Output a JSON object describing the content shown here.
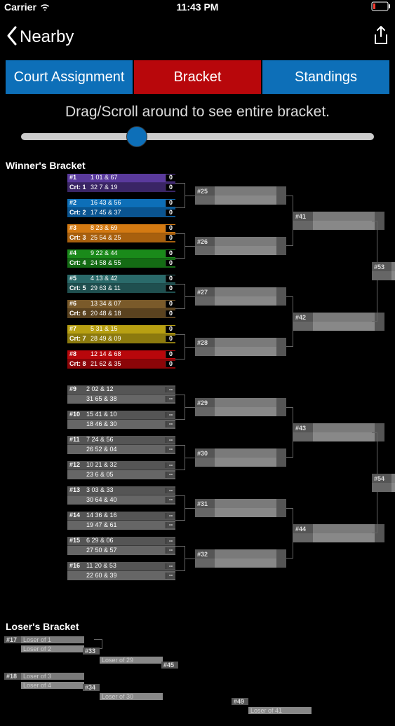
{
  "status": {
    "carrier": "Carrier",
    "time": "11:43 PM"
  },
  "nav": {
    "back_label": "Nearby"
  },
  "tabs": {
    "court_assignment": "Court Assignment",
    "bracket": "Bracket",
    "standings": "Standings"
  },
  "instructions": "Drag/Scroll around to see entire bracket.",
  "winner_header": "Winner's Bracket",
  "loser_header": "Loser's Bracket",
  "winner_r1": [
    {
      "seed": "#1",
      "line1_left": "1",
      "line1": "01 & 67",
      "crt": "Crt: 1",
      "line2_left": "32",
      "line2": "7 & 19",
      "s1": "0",
      "s2": "0",
      "color": "c-purple"
    },
    {
      "seed": "#2",
      "line1_left": "16",
      "line1": "43 & 56",
      "crt": "Crt: 2",
      "line2_left": "17",
      "line2": "45 & 37",
      "s1": "0",
      "s2": "0",
      "color": "c-blue1"
    },
    {
      "seed": "#3",
      "line1_left": "8",
      "line1": "23 & 69",
      "crt": "Crt: 3",
      "line2_left": "25",
      "line2": "54 & 25",
      "s1": "0",
      "s2": "0",
      "color": "c-orange"
    },
    {
      "seed": "#4",
      "line1_left": "9",
      "line1": "22 & 44",
      "crt": "Crt: 4",
      "line2_left": "24",
      "line2": "58 & 55",
      "s1": "0",
      "s2": "0",
      "color": "c-green"
    },
    {
      "seed": "#5",
      "line1_left": "4",
      "line1": "13 & 42",
      "crt": "Crt: 5",
      "line2_left": "29",
      "line2": "63 & 11",
      "s1": "0",
      "s2": "0",
      "color": "c-teal"
    },
    {
      "seed": "#6",
      "line1_left": "13",
      "line1": "34 & 07",
      "crt": "Crt: 6",
      "line2_left": "20",
      "line2": "48 & 18",
      "s1": "0",
      "s2": "0",
      "color": "c-brown"
    },
    {
      "seed": "#7",
      "line1_left": "5",
      "line1": "31 & 15",
      "crt": "Crt: 7",
      "line2_left": "28",
      "line2": "49 & 09",
      "s1": "0",
      "s2": "0",
      "color": "c-gold"
    },
    {
      "seed": "#8",
      "line1_left": "12",
      "line1": "14 & 68",
      "crt": "Crt: 8",
      "line2_left": "21",
      "line2": "62 & 35",
      "s1": "0",
      "s2": "0",
      "color": "c-red"
    },
    {
      "seed": "#9",
      "line1_left": "2",
      "line1": "02 & 12",
      "crt": "",
      "line2_left": "31",
      "line2": "65 & 38",
      "s1": "--",
      "s2": "--",
      "color": "c-gray"
    },
    {
      "seed": "#10",
      "line1_left": "15",
      "line1": "41 & 10",
      "crt": "",
      "line2_left": "18",
      "line2": "46 & 30",
      "s1": "--",
      "s2": "--",
      "color": "c-gray"
    },
    {
      "seed": "#11",
      "line1_left": "7",
      "line1": "24 & 56",
      "crt": "",
      "line2_left": "26",
      "line2": "52 & 04",
      "s1": "--",
      "s2": "--",
      "color": "c-gray"
    },
    {
      "seed": "#12",
      "line1_left": "10",
      "line1": "21 & 32",
      "crt": "",
      "line2_left": "23",
      "line2": "6 & 05",
      "s1": "--",
      "s2": "--",
      "color": "c-gray"
    },
    {
      "seed": "#13",
      "line1_left": "3",
      "line1": "03 & 33",
      "crt": "",
      "line2_left": "30",
      "line2": "64 & 40",
      "s1": "--",
      "s2": "--",
      "color": "c-gray"
    },
    {
      "seed": "#14",
      "line1_left": "14",
      "line1": "36 & 16",
      "crt": "",
      "line2_left": "19",
      "line2": "47 & 61",
      "s1": "--",
      "s2": "--",
      "color": "c-gray"
    },
    {
      "seed": "#15",
      "line1_left": "6",
      "line1": "29 & 06",
      "crt": "",
      "line2_left": "27",
      "line2": "50 & 57",
      "s1": "--",
      "s2": "--",
      "color": "c-gray"
    },
    {
      "seed": "#16",
      "line1_left": "11",
      "line1": "20 & 53",
      "crt": "",
      "line2_left": "22",
      "line2": "60 & 39",
      "s1": "--",
      "s2": "--",
      "color": "c-gray"
    }
  ],
  "winner_r2": [
    "#25",
    "#26",
    "#27",
    "#28",
    "#29",
    "#30",
    "#31",
    "#32"
  ],
  "winner_r3": [
    "#41",
    "#42",
    "#43",
    "#44"
  ],
  "winner_r4": [
    "#53",
    "#54"
  ],
  "loser_r1": [
    {
      "seed": "#17",
      "a": "Loser of 1",
      "b": "Loser of 2"
    },
    {
      "seed": "#18",
      "a": "Loser of 3",
      "b": "Loser of 4"
    }
  ],
  "loser_r2": [
    {
      "seed": "#33",
      "sub": "Loser of 29"
    },
    {
      "seed": "#34",
      "sub": "Loser of 30"
    }
  ],
  "loser_r3": [
    {
      "seed": "#45"
    },
    {
      "seed": "#49",
      "sub": "Loser of 41"
    }
  ]
}
